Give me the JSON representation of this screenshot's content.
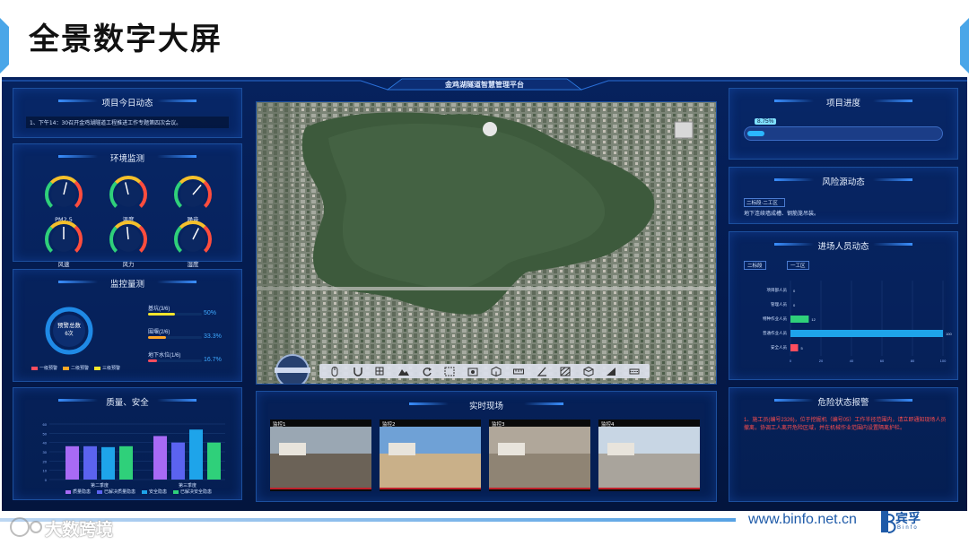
{
  "slide": {
    "title": "全景数字大屏"
  },
  "platform": {
    "title": "金鸡湖隧道智慧管理平台"
  },
  "panels": {
    "today": {
      "title": "项目今日动态",
      "text": "1、下午14：30召开金鸡湖隧道工程推进工作专题第四次会议。"
    },
    "env": {
      "title": "环境监测",
      "gauges": [
        {
          "label": "PM2.5",
          "value": 0.55
        },
        {
          "label": "温度",
          "value": 0.45
        },
        {
          "label": "噪音",
          "value": 0.65
        },
        {
          "label": "风速",
          "value": 0.5
        },
        {
          "label": "风力",
          "value": 0.48
        },
        {
          "label": "湿度",
          "value": 0.6
        }
      ]
    },
    "monitor": {
      "title": "监控量测",
      "donut_label": "预警总数",
      "donut_sub": "6次",
      "legend": [
        "一级预警",
        "二级预警",
        "三级预警"
      ],
      "items": [
        {
          "label": "基坑(3/6)",
          "percent": "50%",
          "fill": 0.5,
          "color": "#f5e52b"
        },
        {
          "label": "围堰(2/6)",
          "percent": "33.3%",
          "fill": 0.333,
          "color": "#ffa726"
        },
        {
          "label": "地下水位(1/6)",
          "percent": "16.7%",
          "fill": 0.167,
          "color": "#ff4d5e"
        }
      ]
    },
    "quality": {
      "title": "质量、安全",
      "categories": [
        "第二季度",
        "第三季度"
      ],
      "legend": [
        "质量隐患",
        "已解决质量隐患",
        "安全隐患",
        "已解决安全隐患"
      ],
      "colors": [
        "#a86af5",
        "#5b63f0",
        "#1ea4ea",
        "#2fd07a"
      ],
      "values": [
        [
          36,
          36,
          35,
          36
        ],
        [
          47,
          40,
          54,
          40
        ]
      ]
    },
    "live": {
      "title": "实时现场",
      "cams": [
        "监控1",
        "监控2",
        "监控3",
        "监控4"
      ]
    },
    "progress": {
      "title": "项目进度",
      "value": "8.75%",
      "fill": 0.0875
    },
    "risk": {
      "title": "风险源动态",
      "select": "二标段·二工区",
      "text": "地下连续墙成槽、钢筋笼吊装。"
    },
    "personnel": {
      "title": "进场人员动态",
      "select1": "二标段",
      "select2": "一工区",
      "rows": [
        "项目部人员",
        "管理人员",
        "特种作业人员",
        "普通作业人员",
        "安全人员"
      ],
      "values": [
        0,
        0,
        12,
        100,
        5
      ]
    },
    "alarm": {
      "title": "危险状态报警",
      "text": "1、施工员(编号2326)，位于挖掘机（编号05）工作半径范围内，请立即通知现场人员撤离，协调工人离开危险区域，并在机械作业范围内设置隔离护栏。"
    }
  },
  "footer": {
    "url": "www.binfo.net.cn",
    "brand": "宾孚",
    "brand_sub": "Binfo",
    "watermark": "大数跨境"
  }
}
